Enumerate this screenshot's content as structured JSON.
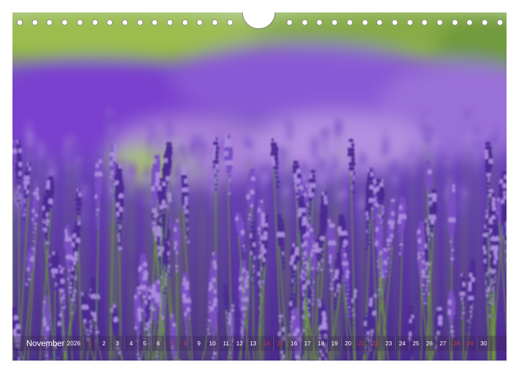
{
  "calendar": {
    "month": "November",
    "year": "2026",
    "days": [
      {
        "label": "1",
        "holiday": true
      },
      {
        "label": "2",
        "holiday": false
      },
      {
        "label": "3",
        "holiday": false
      },
      {
        "label": "4",
        "holiday": false
      },
      {
        "label": "5",
        "holiday": false
      },
      {
        "label": "6",
        "holiday": false
      },
      {
        "label": "7",
        "holiday": true
      },
      {
        "label": "8",
        "holiday": true
      },
      {
        "label": "9",
        "holiday": false
      },
      {
        "label": "10",
        "holiday": false
      },
      {
        "label": "11",
        "holiday": false
      },
      {
        "label": "12",
        "holiday": false
      },
      {
        "label": "13",
        "holiday": false
      },
      {
        "label": "14",
        "holiday": true
      },
      {
        "label": "15",
        "holiday": true
      },
      {
        "label": "16",
        "holiday": false
      },
      {
        "label": "17",
        "holiday": false
      },
      {
        "label": "18",
        "holiday": false
      },
      {
        "label": "19",
        "holiday": false
      },
      {
        "label": "20",
        "holiday": false
      },
      {
        "label": "21",
        "holiday": true
      },
      {
        "label": "22",
        "holiday": true
      },
      {
        "label": "23",
        "holiday": false
      },
      {
        "label": "24",
        "holiday": false
      },
      {
        "label": "25",
        "holiday": false
      },
      {
        "label": "26",
        "holiday": false
      },
      {
        "label": "27",
        "holiday": false
      },
      {
        "label": "28",
        "holiday": true
      },
      {
        "label": "29",
        "holiday": true
      },
      {
        "label": "30",
        "holiday": false
      }
    ]
  },
  "photo": {
    "subject": "lavender-field"
  },
  "colors": {
    "lavender_dark": "#4b2a93",
    "lavender_mid": "#7a4fc4",
    "lavender_light": "#a98ae0",
    "stem_green": "#6f9a3a",
    "background_green": "#8fb04a",
    "holiday_red": "#d23a3a"
  }
}
